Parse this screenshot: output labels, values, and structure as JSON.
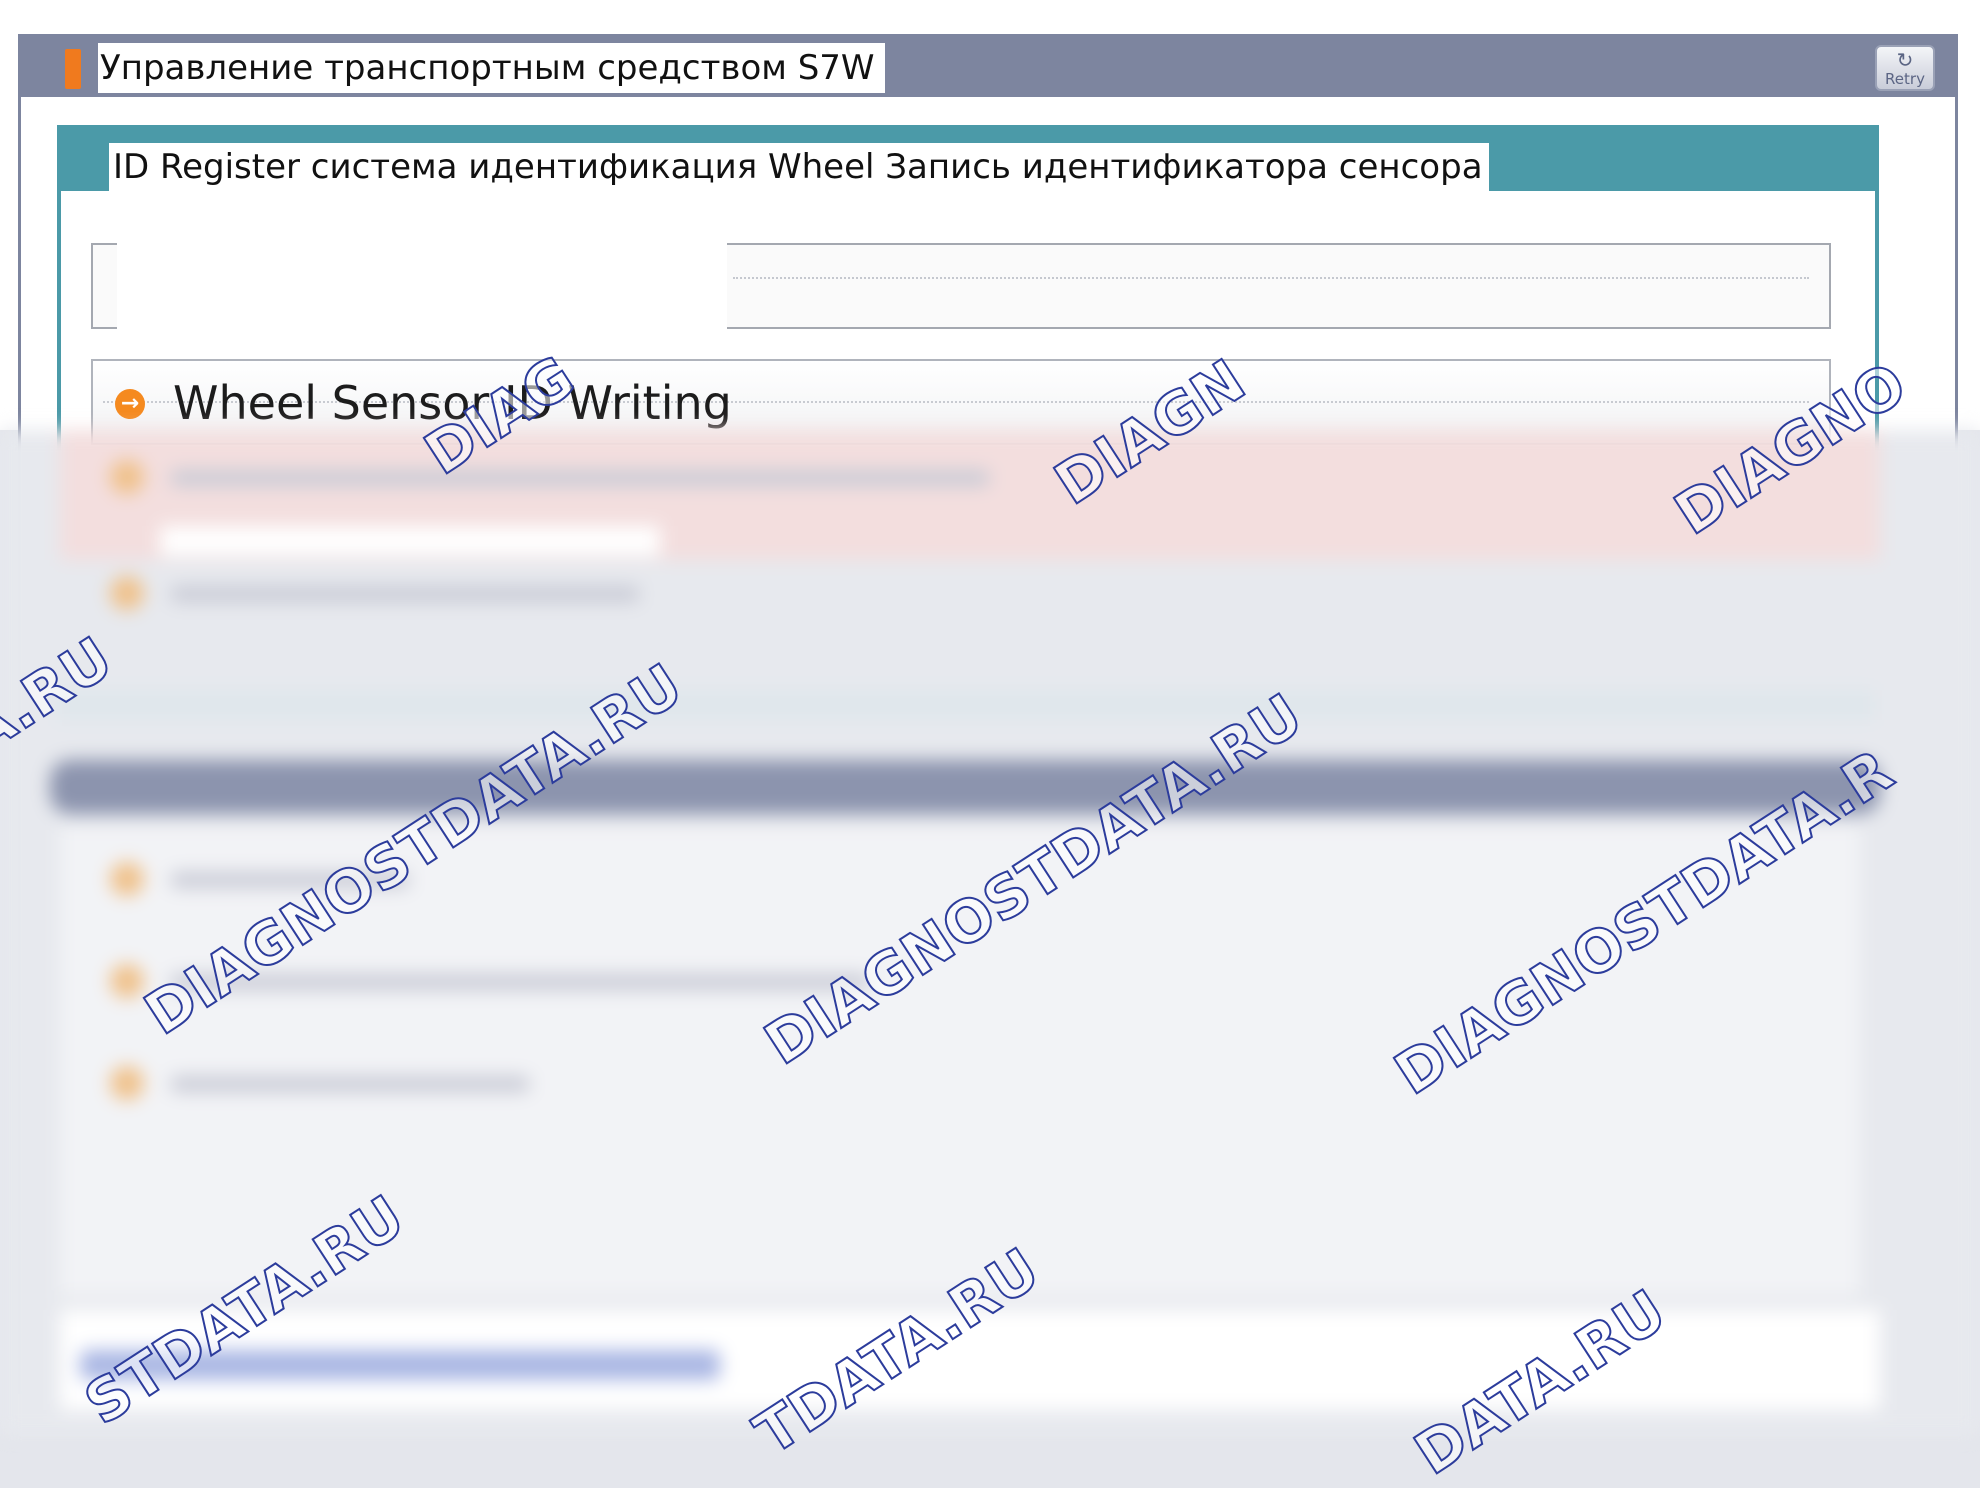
{
  "window": {
    "title": "Управление транспортным средством S7W",
    "retry_label": "Retry"
  },
  "panel": {
    "title": "ID Register система идентификация Wheel Запись идентификатора сенсора"
  },
  "rows": [
    {
      "label": "Wheel Sensor ID Writing",
      "icon": "arrow-right-circle-icon"
    }
  ],
  "watermark": {
    "text": "DIAGNOSTDATA.RU",
    "partials": [
      "DIAG",
      "DIAGN",
      "DIAGNO",
      "A.RU",
      "DIAGNOSTDATA.R",
      "STDATA.RU",
      "TDATA.RU",
      "DATA.RU"
    ]
  },
  "colors": {
    "titlebar": "#7d859f",
    "panel_header": "#4b9aa8",
    "selection_outline": "#e21b1b",
    "row_icon": "#f58a1f",
    "watermark_outline": "#2c3c9c"
  }
}
